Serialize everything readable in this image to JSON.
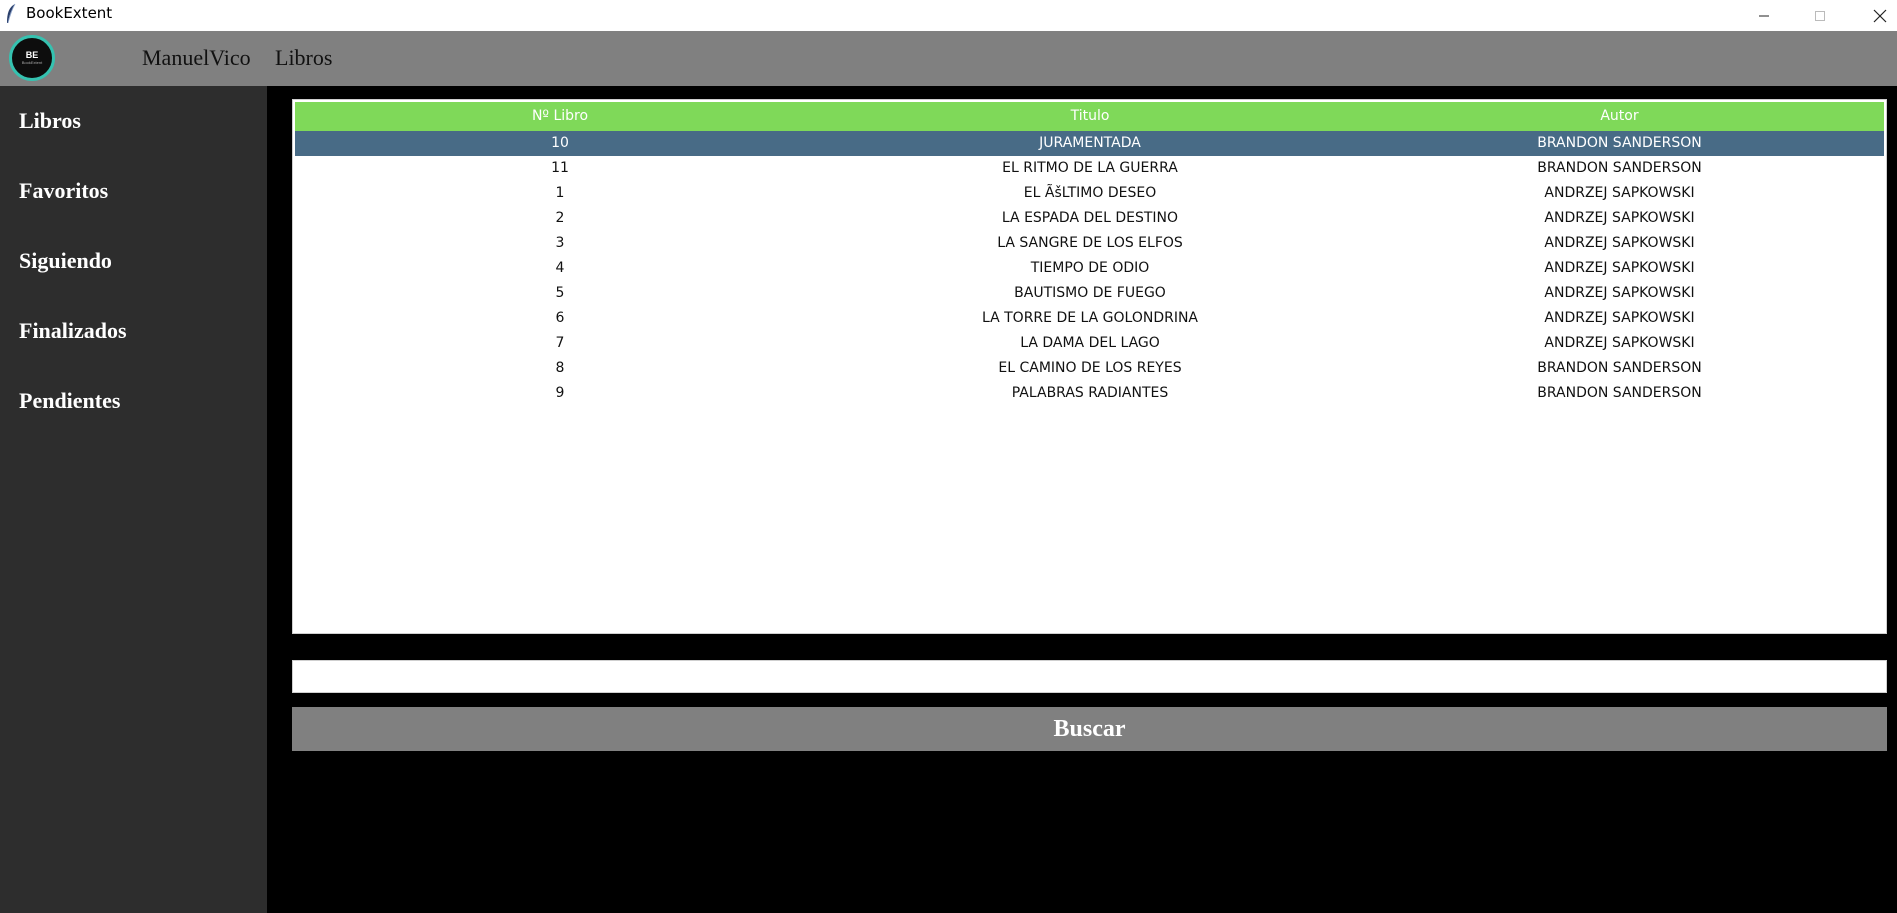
{
  "window": {
    "title": "BookExtent"
  },
  "header": {
    "logo": {
      "initials": "BE",
      "subtitle": "BookExtent"
    },
    "nav": [
      {
        "label": "ManuelVico"
      },
      {
        "label": "Libros"
      }
    ]
  },
  "sidebar": {
    "items": [
      {
        "label": "Libros"
      },
      {
        "label": "Favoritos"
      },
      {
        "label": "Siguiendo"
      },
      {
        "label": "Finalizados"
      },
      {
        "label": "Pendientes"
      }
    ]
  },
  "table": {
    "columns": [
      "Nº Libro",
      "Titulo",
      "Autor"
    ],
    "rows": [
      [
        "10",
        "JURAMENTADA",
        "BRANDON SANDERSON"
      ],
      [
        "11",
        "EL RITMO DE LA GUERRA",
        "BRANDON SANDERSON"
      ],
      [
        "1",
        "EL ÃšLTIMO DESEO",
        "ANDRZEJ SAPKOWSKI"
      ],
      [
        "2",
        "LA ESPADA DEL DESTINO",
        "ANDRZEJ SAPKOWSKI"
      ],
      [
        "3",
        "LA SANGRE DE LOS ELFOS",
        "ANDRZEJ SAPKOWSKI"
      ],
      [
        "4",
        "TIEMPO DE ODIO",
        "ANDRZEJ SAPKOWSKI"
      ],
      [
        "5",
        "BAUTISMO DE FUEGO",
        "ANDRZEJ SAPKOWSKI"
      ],
      [
        "6",
        "LA TORRE DE LA GOLONDRINA",
        "ANDRZEJ SAPKOWSKI"
      ],
      [
        "7",
        "LA DAMA DEL LAGO",
        "ANDRZEJ SAPKOWSKI"
      ],
      [
        "8",
        "EL CAMINO DE LOS REYES",
        "BRANDON SANDERSON"
      ],
      [
        "9",
        "PALABRAS RADIANTES",
        "BRANDON SANDERSON"
      ]
    ],
    "selected_row": 0
  },
  "search": {
    "value": "",
    "placeholder": "",
    "button_label": "Buscar"
  },
  "colors": {
    "header_bg": "#808080",
    "sidebar_bg": "#2d2d2d",
    "table_header_bg": "#7fd959",
    "selected_row_bg": "#486b86",
    "button_bg": "#808080",
    "logo_ring": "#35c2b0"
  },
  "icons": {
    "app": "feather-icon",
    "minimize": "minimize-icon",
    "maximize": "maximize-icon",
    "close": "close-icon"
  }
}
